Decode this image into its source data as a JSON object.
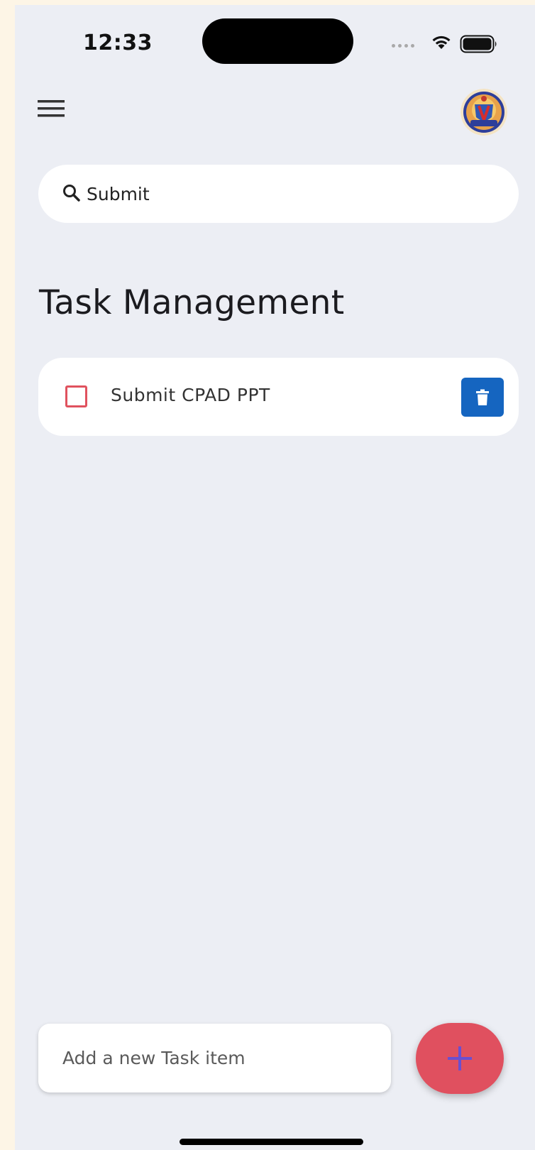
{
  "status_bar": {
    "time": "12:33"
  },
  "header": {
    "menu_icon": "hamburger-menu-icon",
    "avatar": "university-crest-avatar"
  },
  "search": {
    "icon": "search-icon",
    "value": "Submit"
  },
  "page": {
    "title": "Task Management"
  },
  "tasks": [
    {
      "label": "Submit CPAD PPT",
      "checked": false,
      "delete_icon": "trash-icon"
    }
  ],
  "new_task": {
    "placeholder": "Add a new Task item",
    "value": ""
  },
  "fab": {
    "icon": "plus-icon"
  },
  "colors": {
    "background": "#eceef4",
    "checkbox_border": "#e0525e",
    "delete_button": "#1565c0",
    "fab": "#e0505f",
    "fab_icon": "#6a4fd0"
  }
}
